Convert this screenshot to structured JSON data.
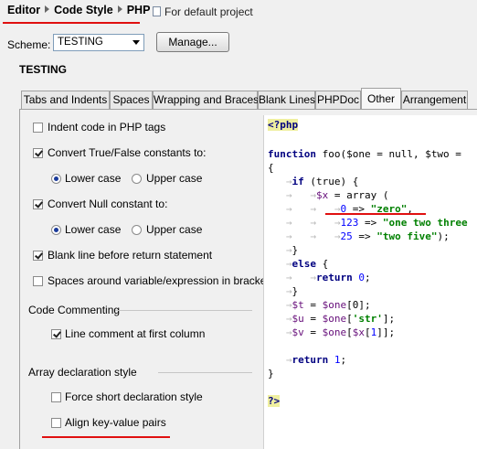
{
  "header": {
    "breadcrumb": [
      "Editor",
      "Code Style",
      "PHP"
    ],
    "project_note": "For default project"
  },
  "scheme": {
    "label": "Scheme:",
    "selected": "TESTING",
    "manage_label": "Manage...",
    "title": "TESTING"
  },
  "tabs": [
    {
      "label": "Tabs and Indents"
    },
    {
      "label": "Spaces"
    },
    {
      "label": "Wrapping and Braces"
    },
    {
      "label": "Blank Lines"
    },
    {
      "label": "PHPDoc"
    },
    {
      "label": "Other"
    },
    {
      "label": "Arrangement"
    }
  ],
  "options": {
    "indent_php_tags": "Indent code in PHP tags",
    "convert_truefalse": "Convert True/False constants to:",
    "tf_lower": "Lower case",
    "tf_upper": "Upper case",
    "convert_null": "Convert Null constant to:",
    "null_lower": "Lower case",
    "null_upper": "Upper case",
    "blank_before_return": "Blank line before return statement",
    "spaces_around_var": "Spaces around variable/expression in brackets"
  },
  "code_commenting": {
    "title": "Code Commenting",
    "line_comment_first_col": "Line comment at first column"
  },
  "array_decl": {
    "title": "Array declaration style",
    "force_short": "Force short declaration style",
    "align_kv": "Align key-value pairs"
  },
  "code_preview": {
    "open_tag": "<?php",
    "func_kw": "function",
    "func_sig": " foo($one = null, $two =",
    "brace_open": "{",
    "if_kw": "if",
    "if_cond": " (true) {",
    "x_var": "$x",
    "array_decl": " = array (",
    "k0": "0",
    "arrow": " => ",
    "v0": "\"zero\"",
    "k1": "123",
    "v1": "\"one two three",
    "k2": "25",
    "v2": "\"two five\"",
    "comma": ",",
    "end_arr": ");",
    "if_close": "}",
    "else_kw": "else",
    "else_open": " {",
    "return_kw": "return",
    "ret0": "0",
    "semi": ";",
    "else_close": "}",
    "t_var": "$t",
    "t_rhs_var": "$one",
    "t_rhs": "[0];",
    "u_var": "$u",
    "u_rhs_var": "$one",
    "u_rhs_open": "[",
    "u_str": "'str'",
    "u_rhs_close": "];",
    "v_var": "$v",
    "v_rhs_var": "$one",
    "v_rhs_open": "[",
    "v_inner_var": "$x",
    "v_inner_open": "[",
    "v_num": "1",
    "v_rhs_close": "]];",
    "eq": " = ",
    "return2_kw": "return",
    "ret1": "1",
    "brace_close": "}",
    "close_tag": "?>"
  },
  "colors": {
    "annotation_red": "#e01010",
    "keyword": "#000080",
    "string": "#008000",
    "number": "#0000ff",
    "variable": "#660e7a"
  }
}
